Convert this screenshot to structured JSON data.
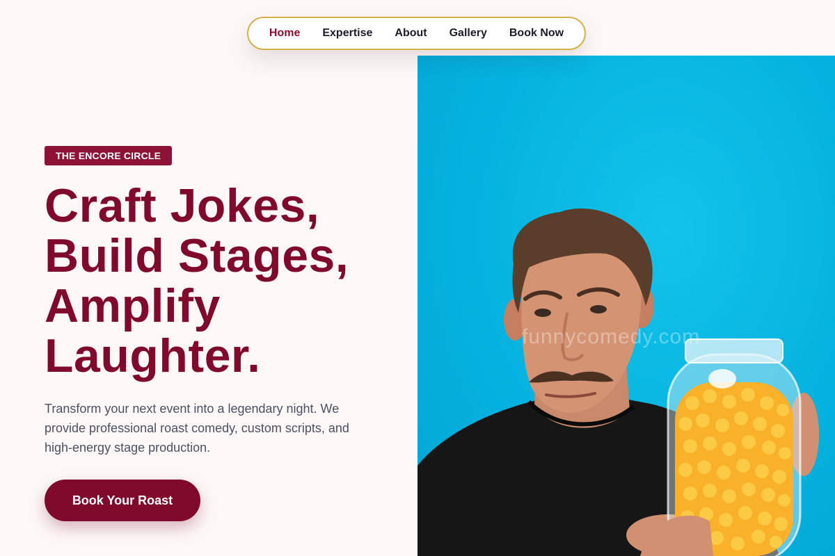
{
  "nav": {
    "items": [
      {
        "label": "Home",
        "active": true
      },
      {
        "label": "Expertise",
        "active": false
      },
      {
        "label": "About",
        "active": false
      },
      {
        "label": "Gallery",
        "active": false
      },
      {
        "label": "Book Now",
        "active": false
      }
    ]
  },
  "hero": {
    "badge": "THE ENCORE CIRCLE",
    "headline": [
      "Craft Jokes,",
      "Build Stages,",
      "Amplify",
      "Laughter."
    ],
    "description": "Transform your next event into a legendary night. We provide professional roast comedy, custom scripts, and high-energy stage production.",
    "cta_label": "Book Your Roast"
  },
  "photo": {
    "subject": "man-with-cheese-puff-jar",
    "watermark": "funnycomedy.com"
  },
  "colors": {
    "page_background": "#fdf8f7",
    "brand": "#800a2c",
    "badge": "#8e1236",
    "nav_border": "#d4b24a",
    "photo_background": "#05b2df",
    "body_text": "#4b5162"
  }
}
